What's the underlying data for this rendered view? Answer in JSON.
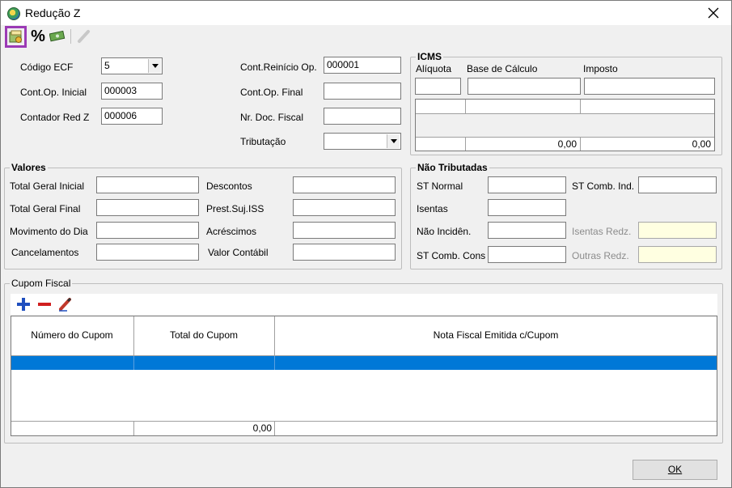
{
  "window": {
    "title": "Redução Z"
  },
  "toolbar": {
    "buttons": [
      {
        "icon": "save-icon"
      },
      {
        "icon": "percent-icon",
        "glyph": "%"
      },
      {
        "icon": "money-icon"
      },
      {
        "icon": "edit-icon"
      }
    ]
  },
  "header": {
    "codigo_ecf_label": "Código ECF",
    "codigo_ecf_value": "5",
    "cont_op_inicial_label": "Cont.Op. Inicial",
    "cont_op_inicial_value": "000003",
    "contador_red_z_label": "Contador Red Z",
    "contador_red_z_value": "000006",
    "cont_reinicio_label": "Cont.Reinício Op.",
    "cont_reinicio_value": "000001",
    "cont_op_final_label": "Cont.Op. Final",
    "cont_op_final_value": "",
    "nr_doc_fiscal_label": "Nr. Doc. Fiscal",
    "nr_doc_fiscal_value": "",
    "tributacao_label": "Tributação",
    "tributacao_value": ""
  },
  "icms": {
    "title": "ICMS",
    "aliquota_label": "Alíquota",
    "base_label": "Base de Cálculo",
    "imposto_label": "Imposto",
    "total_base": "0,00",
    "total_imposto": "0,00"
  },
  "valores": {
    "title": "Valores",
    "total_geral_inicial": "Total Geral Inicial",
    "total_geral_final": "Total Geral Final",
    "movimento_do_dia": "Movimento do Dia",
    "cancelamentos": "Cancelamentos",
    "descontos": "Descontos",
    "prest_suj_iss": "Prest.Suj.ISS",
    "acrescimos": "Acréscimos",
    "valor_contabil": "Valor Contábil"
  },
  "nao_tributadas": {
    "title": "Não Tributadas",
    "st_normal": "ST Normal",
    "st_comb_ind": "ST Comb. Ind.",
    "isentas": "Isentas",
    "nao_incidencia": "Não Incidên.",
    "isentas_redz": "Isentas Redz.",
    "st_comb_cons": "ST Comb. Cons",
    "outras_redz": "Outras Redz."
  },
  "cupom": {
    "title": "Cupom Fiscal",
    "columns": [
      "Número do Cupom",
      "Total do Cupom",
      "Nota Fiscal Emitida c/Cupom"
    ],
    "total": "0,00",
    "selected_row_color": "#0078d7"
  },
  "footer": {
    "ok_label": "OK"
  }
}
